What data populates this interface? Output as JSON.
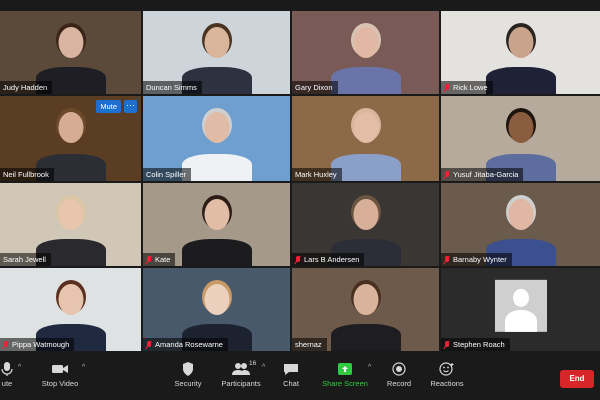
{
  "participants": [
    {
      "name": "Judy Hadden",
      "muted": false,
      "bg": "#5b4a3a",
      "skin": "#d9b4a0",
      "hair": "#3a2417",
      "shirt": "#1e1e24"
    },
    {
      "name": "Duncan Simms",
      "muted": false,
      "bg": "#cdd5da",
      "skin": "#d9b59c",
      "hair": "#4a3321",
      "shirt": "#2d3140"
    },
    {
      "name": "Gary Dixon",
      "muted": false,
      "bg": "#7a5a56",
      "skin": "#e1b8a3",
      "hair": "#d8c3b2",
      "shirt": "#6b74a8"
    },
    {
      "name": "Rick Lowe",
      "muted": true,
      "bg": "#e4e2de",
      "skin": "#c9a38c",
      "hair": "#2a2420",
      "shirt": "#1f2236"
    },
    {
      "name": "Neil Fullbrook",
      "muted": false,
      "bg": "#5a3d22",
      "skin": "#d6ad93",
      "hair": "#6b4a2c",
      "shirt": "#2c2e35"
    },
    {
      "name": "Colin Spiller",
      "muted": false,
      "bg": "#6f9fcf",
      "skin": "#e0bca6",
      "hair": "#cfcfcf",
      "shirt": "#eef2f4"
    },
    {
      "name": "Mark Huxley",
      "muted": false,
      "bg": "#8d6a47",
      "skin": "#e3bda6",
      "hair": "#d9b79e",
      "shirt": "#8ba0c8"
    },
    {
      "name": "Yusuf Jitaba-Garcia",
      "muted": true,
      "bg": "#b5aa9c",
      "skin": "#8a5d41",
      "hair": "#1e140e",
      "shirt": "#5d6e9e"
    },
    {
      "name": "Sarah Jewell",
      "muted": false,
      "bg": "#d1c7b7",
      "skin": "#e8c6ae",
      "hair": "#d9c7a5",
      "shirt": "#2a2a2e"
    },
    {
      "name": "Kate",
      "muted": true,
      "bg": "#a59a8a",
      "skin": "#e2bda5",
      "hair": "#2b1d16",
      "shirt": "#1c1c1f"
    },
    {
      "name": "Lars B Andersen",
      "muted": true,
      "bg": "#3a3633",
      "skin": "#d8b09a",
      "hair": "#6b5541",
      "shirt": "#2b2d37"
    },
    {
      "name": "Barnaby Wynter",
      "muted": true,
      "bg": "#6a5b4d",
      "skin": "#e0b7a2",
      "hair": "#cfcfcf",
      "shirt": "#3c4f8e"
    },
    {
      "name": "Pippa Watmough",
      "muted": true,
      "bg": "#dfe2e3",
      "skin": "#e6c4ae",
      "hair": "#5a2f1f",
      "shirt": "#1f2a40"
    },
    {
      "name": "Amanda Rosewarne",
      "muted": true,
      "bg": "#49596c",
      "skin": "#ead0bd",
      "hair": "#c79a66",
      "shirt": "#1d2230"
    },
    {
      "name": "shernaz",
      "muted": false,
      "bg": "#6e5a4b",
      "skin": "#d9b39b",
      "hair": "#4a3020",
      "shirt": "#1e1e22"
    },
    {
      "name": "Stephen Roach",
      "muted": true,
      "bg": "#2b2b2b",
      "avatar": true
    }
  ],
  "active_tile": {
    "mute_label": "Mute",
    "more_label": "···"
  },
  "toolbar": {
    "mute_label": "ute",
    "video_label": "Stop Video",
    "security_label": "Security",
    "participants_label": "Participants",
    "participants_count": "16",
    "chat_label": "Chat",
    "share_label": "Share Screen",
    "record_label": "Record",
    "reactions_label": "Reactions",
    "end_label": "End",
    "share_color": "#2ecc40"
  }
}
